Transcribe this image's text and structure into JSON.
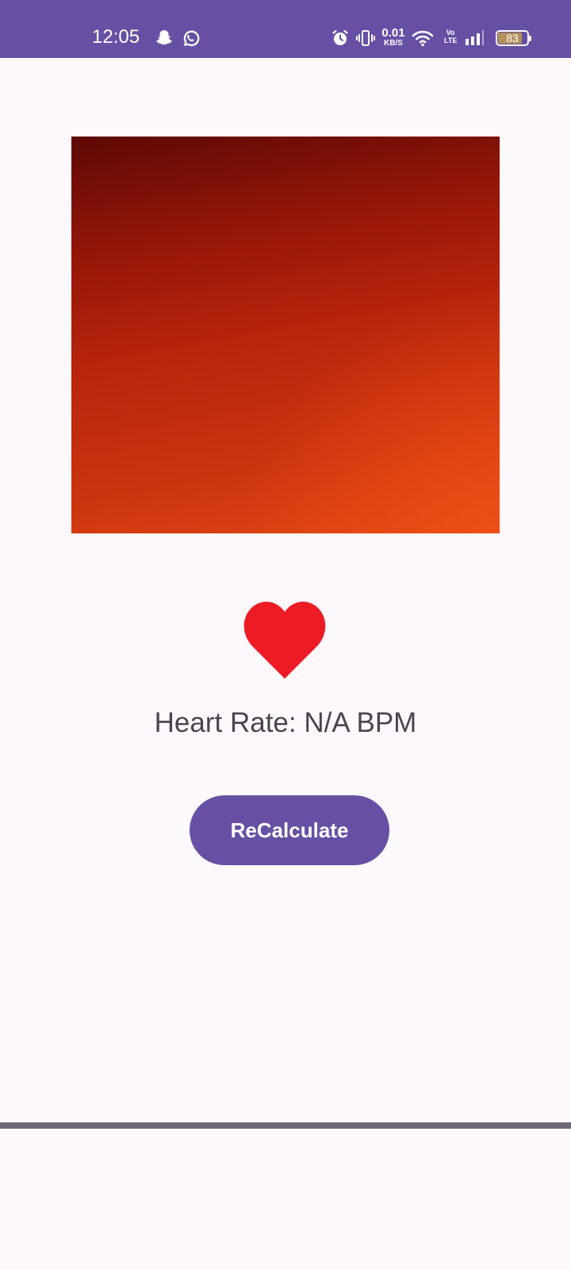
{
  "status_bar": {
    "time": "12:05",
    "background": "#6750a4",
    "notification_icons": [
      "snapchat-icon",
      "whatsapp-icon"
    ],
    "system_icons": [
      "alarm-icon",
      "vibrate-icon",
      "wifi-icon",
      "cellular-signal-icon"
    ],
    "network_speed_value": "0.01",
    "network_speed_unit": "KB/S",
    "volte_label": "Vo\nLTE",
    "battery_level": "83"
  },
  "camera_preview": {
    "colors": [
      "#5e0906",
      "#b9240c",
      "#e24615"
    ]
  },
  "heart": {
    "icon": "heart-icon",
    "color": "#ed1c24"
  },
  "heart_rate_text": "Heart Rate: N/A BPM",
  "recalculate_button": {
    "label": "ReCalculate",
    "color": "#6750a4"
  }
}
